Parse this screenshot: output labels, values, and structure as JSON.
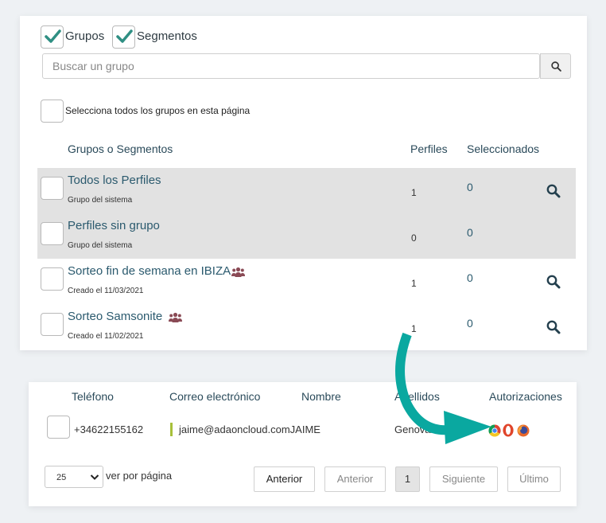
{
  "filters": {
    "groups_label": "Grupos",
    "segments_label": "Segmentos"
  },
  "search": {
    "placeholder": "Buscar un grupo"
  },
  "select_all_label": "Selecciona todos los grupos en esta página",
  "table": {
    "headers": {
      "name": "Grupos o Segmentos",
      "profiles": "Perfiles",
      "selected": "Seleccionados"
    },
    "rows": [
      {
        "name": "Todos los Perfiles",
        "subtitle": "Grupo del sistema",
        "profiles": "1",
        "selected": "0",
        "searchable": true,
        "group_icon": false
      },
      {
        "name": "Perfiles sin grupo",
        "subtitle": "Grupo del sistema",
        "profiles": "0",
        "selected": "0",
        "searchable": false,
        "group_icon": false
      },
      {
        "name": "Sorteo fin de semana en IBIZA",
        "subtitle": "Creado el 11/03/2021",
        "profiles": "1",
        "selected": "0",
        "searchable": true,
        "group_icon": true
      },
      {
        "name": "Sorteo Samsonite",
        "subtitle": "Creado el 11/02/2021",
        "profiles": "1",
        "selected": "0",
        "searchable": true,
        "group_icon": true
      }
    ]
  },
  "contacts": {
    "headers": {
      "phone": "Teléfono",
      "email": "Correo electrónico",
      "name": "Nombre",
      "surname": "Apellidos",
      "authorizations": "Autorizaciones"
    },
    "rows": [
      {
        "phone": "+34622155162",
        "email_name": "jaime@adaoncloud.comJAIME",
        "surname": "Genovart",
        "auth_icons": [
          "chrome-icon",
          "opera-icon",
          "firefox-icon"
        ]
      }
    ]
  },
  "pagination": {
    "per_page_value": "25",
    "per_page_label": "ver por página",
    "first_label": "Anterior",
    "prev_label": "Anterior",
    "current_page": "1",
    "next_label": "Siguiente",
    "last_label": "Último"
  },
  "colors": {
    "accent_teal": "#0aa8a0",
    "link": "#2b5a6e",
    "group_icon": "#8a4a55",
    "status_bar": "#a7c03a"
  }
}
